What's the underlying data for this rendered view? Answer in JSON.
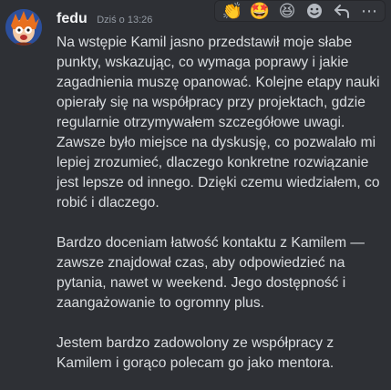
{
  "message": {
    "username": "fedu",
    "timestamp": "Dziś o 13:26",
    "paragraphs": [
      "Na wstępie Kamil jasno przedstawił moje słabe punkty, wskazując, co wymaga poprawy i jakie zagadnienia muszę opanować. Kolejne etapy nauki opierały się na współpracy przy projektach, gdzie regularnie otrzymywałem szczegółowe uwagi. Zawsze było miejsce na dyskusję, co pozwalało mi lepiej zrozumieć, dlaczego konkretne rozwiązanie jest lepsze od innego. Dzięki czemu wiedziałem, co robić i dlaczego.",
      "Bardzo doceniam łatwość kontaktu z Kamilem — zawsze znajdował czas, aby odpowiedzieć na pytania, nawet w weekend. Jego dostępność i zaangażowanie to ogromny plus.",
      "Jestem bardzo zadowolony ze współpracy z Kamilem i gorąco polecam go jako mentora."
    ]
  },
  "toolbar": {
    "reactions": [
      {
        "icon": "clapping-hands-icon",
        "glyph": "👏"
      },
      {
        "icon": "star-struck-icon",
        "glyph": "🤩"
      },
      {
        "icon": "grinning-squinting-icon",
        "glyph": "😆"
      }
    ],
    "actions": [
      {
        "icon": "add-reaction-icon"
      },
      {
        "icon": "reply-icon"
      },
      {
        "icon": "more-options-icon",
        "glyph": "⋯"
      }
    ]
  },
  "colors": {
    "background": "#2e3035",
    "text": "#dbdee1",
    "username": "#f2f3f5",
    "timestamp": "#949ba4"
  }
}
